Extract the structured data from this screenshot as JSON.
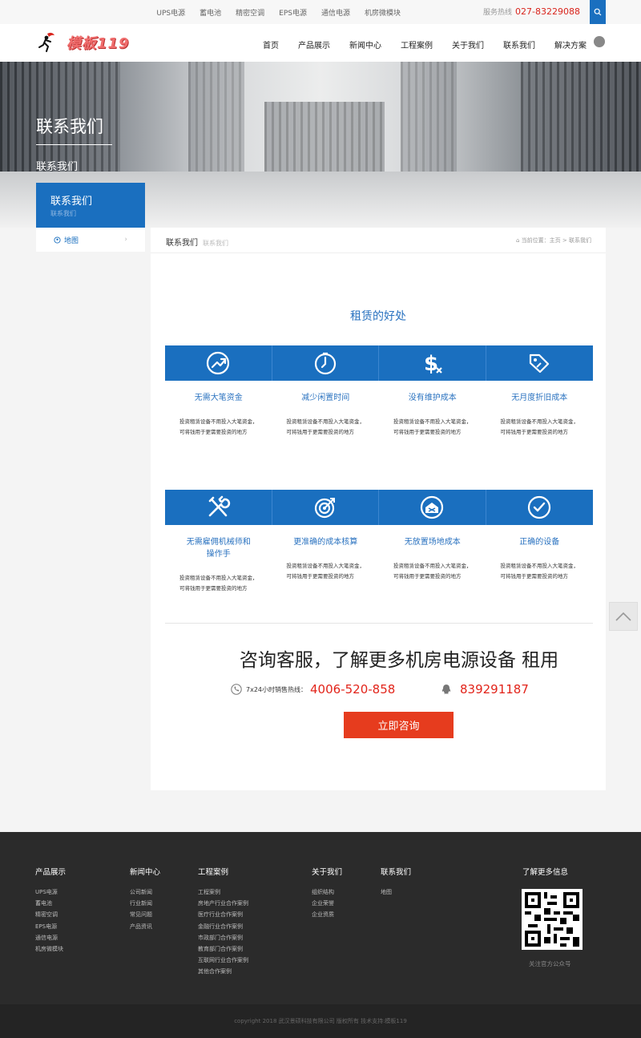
{
  "topbar": {
    "links": [
      "UPS电源",
      "蓄电池",
      "精密空调",
      "EPS电源",
      "通信电源",
      "机房微模块"
    ],
    "hotline_label": "服务热线",
    "hotline_number": "027-83229088"
  },
  "header": {
    "logo_text": "模板119",
    "nav": [
      "首页",
      "产品展示",
      "新闻中心",
      "工程案例",
      "关于我们",
      "联系我们",
      "解决方案"
    ]
  },
  "banner": {
    "title": "联系我们",
    "subtitle": "联系我们",
    "box_title": "联系我们",
    "box_sub": "联系我们"
  },
  "sidebar": {
    "item": "地图"
  },
  "main": {
    "crumb_title": "联系我们",
    "crumb_en": "联系我们",
    "location_label": "当前位置：",
    "location_home": "主页",
    "location_current": "联系我们",
    "section_title": "租赁的好处",
    "benefits_row1": [
      {
        "icon": "trend-up-icon",
        "name": "无需大笔资金",
        "desc": "投资租赁设备不用投入大笔资金，可将钱用于更需要投资的地方"
      },
      {
        "icon": "timer-icon",
        "name": "减少闲置时间",
        "desc": "投资租赁设备不用投入大笔资金，可将钱用于更需要投资的地方"
      },
      {
        "icon": "dollar-x-icon",
        "name": "没有维护成本",
        "desc": "投资租赁设备不用投入大笔资金，可将钱用于更需要投资的地方"
      },
      {
        "icon": "tag-icon",
        "name": "无月度折旧成本",
        "desc": "投资租赁设备不用投入大笔资金，可将钱用于更需要投资的地方"
      }
    ],
    "benefits_row2": [
      {
        "icon": "tools-icon",
        "name": "无需雇佣机械师和操作手",
        "desc": "投资租赁设备不用投入大笔资金，可将钱用于更需要投资的地方"
      },
      {
        "icon": "target-icon",
        "name": "更准确的成本核算",
        "desc": "投资租赁设备不用投入大笔资金，可将钱用于更需要投资的地方"
      },
      {
        "icon": "warehouse-icon",
        "name": "无放置场地成本",
        "desc": "投资租赁设备不用投入大笔资金，可将钱用于更需要投资的地方"
      },
      {
        "icon": "check-circle-icon",
        "name": "正确的设备",
        "desc": "投资租赁设备不用投入大笔资金，可将钱用于更需要投资的地方"
      }
    ],
    "cta_title": "咨询客服，了解更多机房电源设备 租用",
    "hotline_label": "7x24小时销售热线：",
    "hotline_number": "4006-520-858",
    "qq_number": "839291187",
    "cta_button": "立即咨询"
  },
  "footer": {
    "cols": [
      {
        "title": "产品展示",
        "items": [
          "UPS电源",
          "蓄电池",
          "精密空调",
          "EPS电源",
          "通信电源",
          "机房微模块"
        ]
      },
      {
        "title": "新闻中心",
        "items": [
          "公司新闻",
          "行业新闻",
          "常见问题",
          "产品资讯"
        ]
      },
      {
        "title": "工程案例",
        "items": [
          "工程案例",
          "房地产行业合作案例",
          "医疗行业合作案例",
          "金融行业合作案例",
          "市政部门合作案例",
          "教育部门合作案例",
          "互联网行业合作案例",
          "其他合作案例"
        ]
      },
      {
        "title": "关于我们",
        "items": [
          "组织结构",
          "企业荣誉",
          "企业资质"
        ]
      },
      {
        "title": "联系我们",
        "items": [
          "地图"
        ]
      }
    ],
    "qr_title": "了解更多信息",
    "qr_caption": "关注官方公众号"
  },
  "copyright": "copyright 2018 武汉景硕科技有限公司 版权所有 技术支持:模板119"
}
